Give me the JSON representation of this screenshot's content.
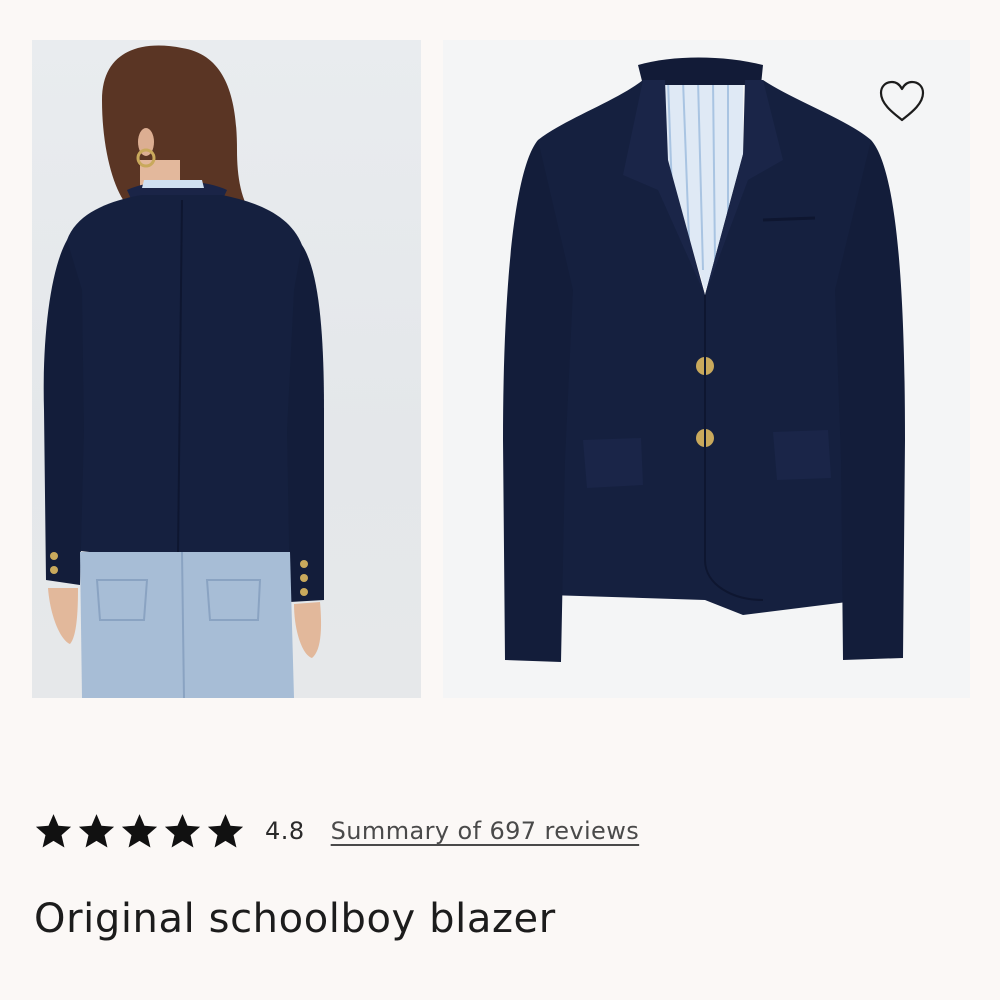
{
  "images": {
    "back_view": {
      "subject": "model-wearing-navy-blazer-back-view"
    },
    "front_view": {
      "subject": "navy-blazer-flat-front-view"
    }
  },
  "wishlist": {
    "icon": "heart-outline-icon"
  },
  "rating": {
    "stars": 5,
    "star_icon": "star-filled-icon",
    "value": "4.8",
    "reviews_link": "Summary of 697 reviews"
  },
  "product": {
    "title": "Original schoolboy blazer"
  },
  "colors": {
    "background": "#fbf8f6",
    "navy": "#15203f",
    "denim": "#a7bdd6",
    "gold": "#c9a95c",
    "text": "#1c1c1c"
  }
}
